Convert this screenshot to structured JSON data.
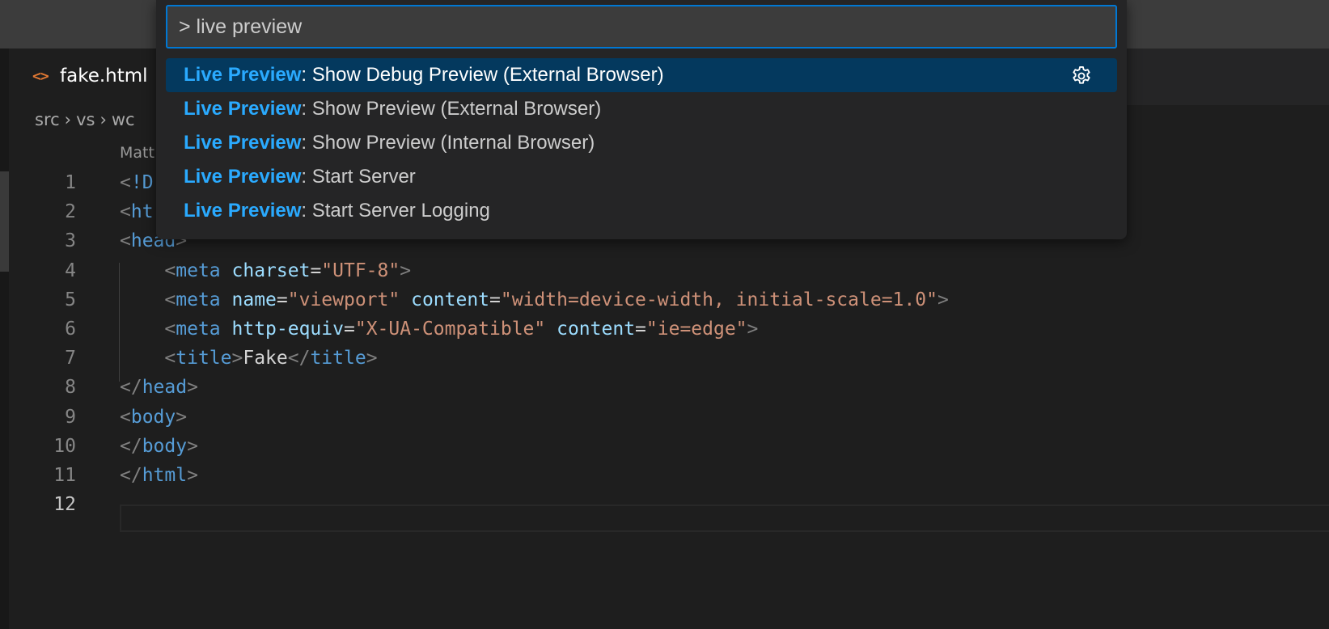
{
  "palette": {
    "input_value": "> live preview",
    "items": [
      {
        "highlight": "Live Preview",
        "rest": ": Show Debug Preview (External Browser)",
        "selected": true
      },
      {
        "highlight": "Live Preview",
        "rest": ": Show Preview (External Browser)",
        "selected": false
      },
      {
        "highlight": "Live Preview",
        "rest": ": Show Preview (Internal Browser)",
        "selected": false
      },
      {
        "highlight": "Live Preview",
        "rest": ": Start Server",
        "selected": false
      },
      {
        "highlight": "Live Preview",
        "rest": ": Start Server Logging",
        "selected": false
      }
    ],
    "selected_item_action_icon": "gear-icon"
  },
  "tab": {
    "icon": "html-file-icon",
    "label": "fake.html"
  },
  "breadcrumb": [
    "src",
    "vs",
    "wc"
  ],
  "codelens": "Matt",
  "editor": {
    "current_line": 12,
    "lines": [
      {
        "n": "1",
        "text": "<!D"
      },
      {
        "n": "2",
        "text": "<ht"
      },
      {
        "n": "3",
        "text": "<head>"
      },
      {
        "n": "4",
        "text": "    <meta charset=\"UTF-8\">"
      },
      {
        "n": "5",
        "text": "    <meta name=\"viewport\" content=\"width=device-width, initial-scale=1.0\">"
      },
      {
        "n": "6",
        "text": "    <meta http-equiv=\"X-UA-Compatible\" content=\"ie=edge\">"
      },
      {
        "n": "7",
        "text": "    <title>Fake</title>"
      },
      {
        "n": "8",
        "text": "</head>"
      },
      {
        "n": "9",
        "text": "<body>"
      },
      {
        "n": "10",
        "text": "</body>"
      },
      {
        "n": "11",
        "text": "</html>"
      },
      {
        "n": "12",
        "text": ""
      }
    ]
  },
  "colors": {
    "accent": "#0078d4",
    "highlight": "#2aaaff",
    "selected_row": "#04395e",
    "tab_icon": "#e37933"
  }
}
